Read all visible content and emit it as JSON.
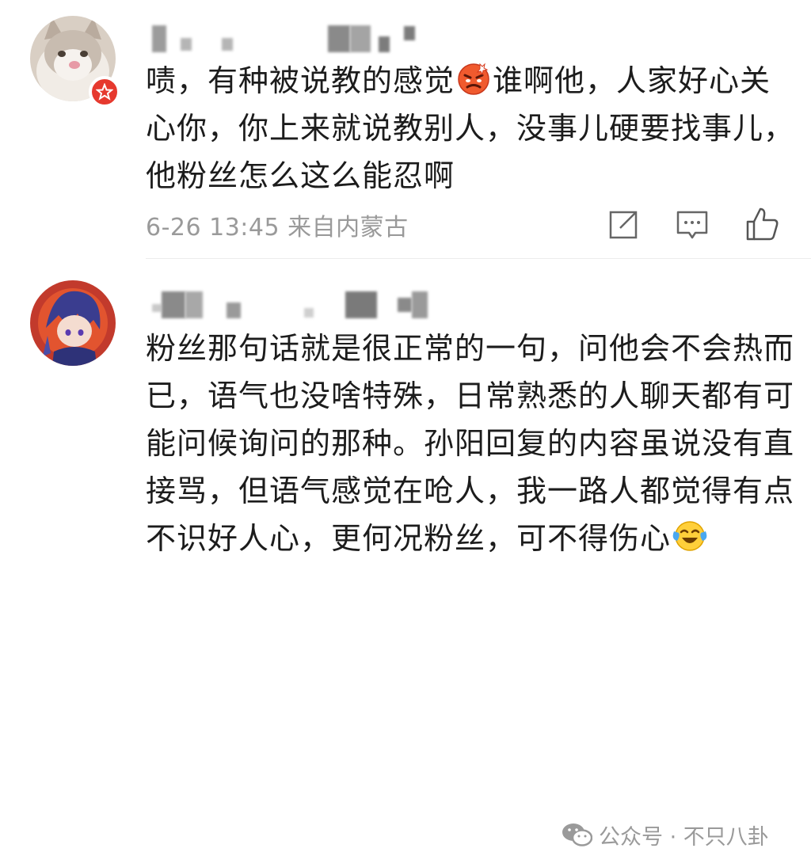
{
  "comments": [
    {
      "text_parts": [
        "啧，有种被说教的感觉",
        "谁啊他，人家好心关心你，你上来就说教别人，没事儿硬要找事儿，他粉丝怎么这么能忍啊"
      ],
      "inline_emoji": "angry-face-emoji",
      "meta": "6-26 13:45  来自内蒙古",
      "icons": [
        "share-icon",
        "comment-icon",
        "like-icon"
      ]
    },
    {
      "text": "粉丝那句话就是很正常的一句，问他会不会热而已，语气也没啥特殊，日常熟悉的人聊天都有可能问候询问的那种。孙阳回复的内容虽说没有直接骂，但语气感觉在呛人，我一路人都觉得有点不识好人心，更何况粉丝，可不得伤心",
      "trailing_emoji": "crying-laughing-emoji"
    }
  ],
  "watermark": {
    "text": "公众号 · 不只八卦",
    "icon": "wechat-icon"
  },
  "colors": {
    "badge": "#e6392e",
    "meta": "#9a9a9a",
    "text": "#1c1c1c"
  }
}
